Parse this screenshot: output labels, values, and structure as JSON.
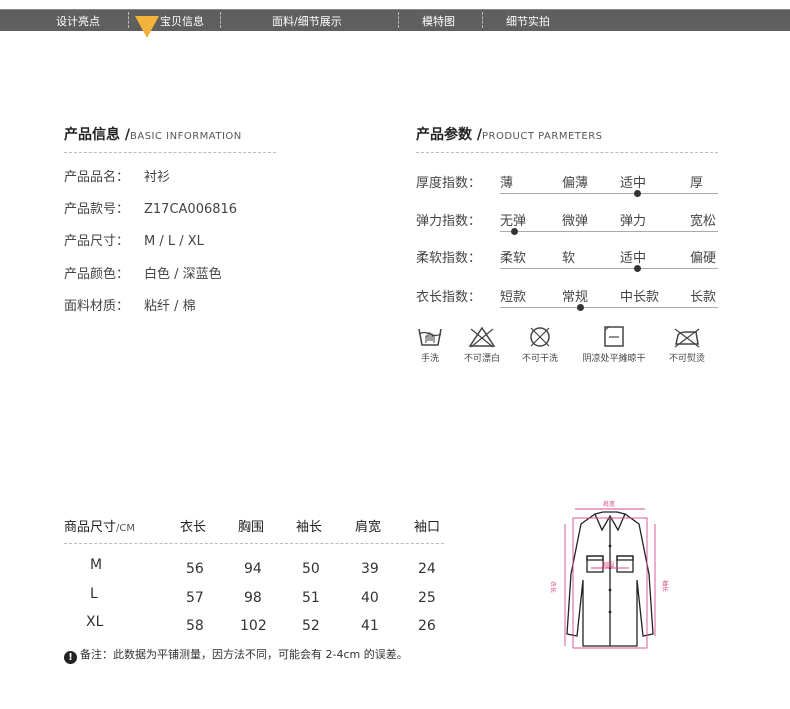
{
  "nav": {
    "items": [
      "设计亮点",
      "宝贝信息",
      "面料/细节展示",
      "模特图",
      "细节实拍"
    ],
    "active_index": 1,
    "accent": "#f3b23a"
  },
  "product_info": {
    "title": "产品信息 /",
    "title_en": "BASIC INFORMATION",
    "rows": [
      {
        "label": "产品品名：",
        "value": "衬衫"
      },
      {
        "label": "产品款号：",
        "value": "Z17CA006816"
      },
      {
        "label": "产品尺寸：",
        "value": "M / L / XL"
      },
      {
        "label": "产品颜色：",
        "value": "白色 / 深蓝色"
      },
      {
        "label": "面料材质：",
        "value": "粘纤 / 棉"
      }
    ]
  },
  "product_params": {
    "title": "产品参数 /",
    "title_en": "PRODUCT PARMETERS",
    "rows": [
      {
        "label": "厚度指数：",
        "options": [
          "薄",
          "偏薄",
          "适中",
          "厚"
        ],
        "selected_index": 2
      },
      {
        "label": "弹力指数：",
        "options": [
          "无弹",
          "微弹",
          "弹力",
          "宽松"
        ],
        "selected_index": 0
      },
      {
        "label": "柔软指数：",
        "options": [
          "柔软",
          "软",
          "适中",
          "偏硬"
        ],
        "selected_index": 2
      },
      {
        "label": "衣长指数：",
        "options": [
          "短款",
          "常规",
          "中长款",
          "长款"
        ],
        "selected_index": 1
      }
    ],
    "care": [
      {
        "icon": "hand-wash-icon",
        "label": "手洗"
      },
      {
        "icon": "no-bleach-icon",
        "label": "不可漂白"
      },
      {
        "icon": "no-dry-clean-icon",
        "label": "不可干洗"
      },
      {
        "icon": "dry-flat-shade-icon",
        "label": "阴凉处平摊晾干"
      },
      {
        "icon": "no-iron-icon",
        "label": "不可熨烫"
      }
    ]
  },
  "size_table": {
    "header_label": "商品尺寸",
    "header_unit": "/CM",
    "columns": [
      "衣长",
      "胸围",
      "袖长",
      "肩宽",
      "袖口"
    ],
    "rows": [
      {
        "size": "M",
        "values": [
          "56",
          "94",
          "50",
          "39",
          "24"
        ]
      },
      {
        "size": "L",
        "values": [
          "57",
          "98",
          "51",
          "40",
          "25"
        ]
      },
      {
        "size": "XL",
        "values": [
          "58",
          "102",
          "52",
          "41",
          "26"
        ]
      }
    ],
    "note": "备注：此数据为平铺测量，因方法不同，可能会有 2-4cm 的误差。",
    "note_icon": "!"
  },
  "diagram": {
    "shoulder_label": "肩宽",
    "chest_label": "胸围",
    "length_label": "衣长",
    "sleeve_label": "袖长",
    "measure_color": "#d44a8a"
  }
}
